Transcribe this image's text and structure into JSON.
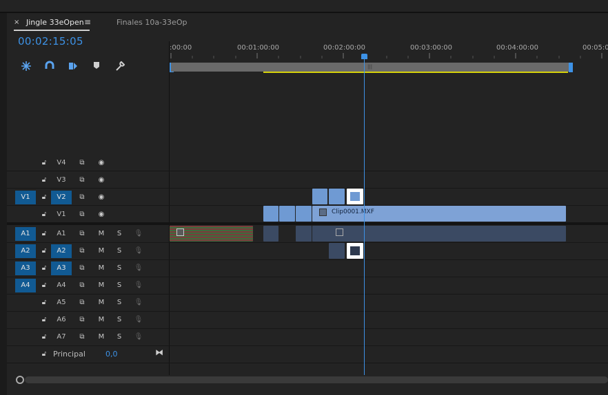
{
  "tabs": {
    "active_label": "Jingle 33eOpen",
    "inactive_label": "Finales 10a-33eOp",
    "close_glyph": "×",
    "menu_glyph": "≡"
  },
  "timecode": "00:02:15:05",
  "ruler": {
    "labels": [
      ":00:00",
      "00:01:00:00",
      "00:02:00:00",
      "00:03:00:00",
      "00:04:00:00",
      "00:05:0"
    ]
  },
  "video_tracks": [
    {
      "name": "V4",
      "source": ""
    },
    {
      "name": "V3",
      "source": ""
    },
    {
      "name": "V2",
      "source": "V1"
    },
    {
      "name": "V1",
      "source": ""
    }
  ],
  "audio_tracks": [
    {
      "name": "A1",
      "source": "A1",
      "m": "M",
      "s": "S"
    },
    {
      "name": "A2",
      "source": "A2",
      "m": "M",
      "s": "S"
    },
    {
      "name": "A3",
      "source": "A3",
      "m": "M",
      "s": "S"
    },
    {
      "name": "A4",
      "source": "A4",
      "m": "M",
      "s": "S"
    },
    {
      "name": "A5",
      "source": "",
      "m": "M",
      "s": "S"
    },
    {
      "name": "A6",
      "source": "",
      "m": "M",
      "s": "S"
    },
    {
      "name": "A7",
      "source": "",
      "m": "M",
      "s": "S"
    }
  ],
  "master": {
    "label": "Principal",
    "value": "0,0"
  },
  "clips": {
    "v1_main_label": "Clip0001.MXF"
  },
  "colors": {
    "accent": "#3d92e6",
    "source_on": "#115a93",
    "video_clip": "#8eb2e0",
    "audio_clip": "#3b4a63",
    "in_out_bar": "#d7d30a"
  }
}
